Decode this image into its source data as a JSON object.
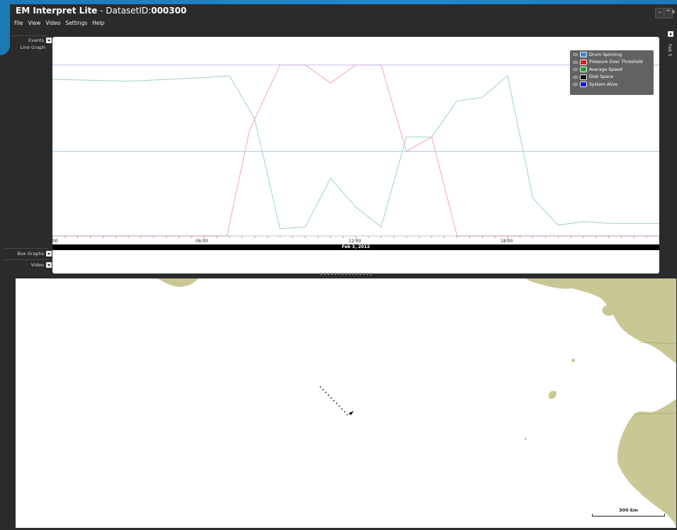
{
  "app": {
    "title_prefix": "EM Interpret Lite",
    "title_sep": " - DatasetID:",
    "dataset_id": "000300",
    "window_controls": {
      "minimize": "–",
      "maximize": "^",
      "close": "x"
    }
  },
  "menu": [
    "File",
    "View",
    "Video",
    "Settings",
    "Help"
  ],
  "rows": {
    "events": "Events",
    "line_graph": "Line Graph",
    "box_graphs": "Box Graphs",
    "video": "Video"
  },
  "timeline": {
    "ticks": [
      "00",
      "06:00",
      "12:00",
      "18:00"
    ],
    "date": "Feb 3, 2012",
    "side_date": "Feb 5"
  },
  "legend": [
    {
      "label": "Drum Spinning",
      "color": "#3a8de0",
      "icon": "eye-icon"
    },
    {
      "label": "Pressure Over Threshold",
      "color": "#e01a1a",
      "icon": "eye-icon"
    },
    {
      "label": "Average Speed",
      "color": "#22a02a",
      "icon": "eye-icon"
    },
    {
      "label": "Disk Space",
      "color": "#111111",
      "icon": "eye-icon"
    },
    {
      "label": "System Alive",
      "color": "#1a1ae0",
      "icon": "eye-icon"
    }
  ],
  "chart_data": {
    "type": "line",
    "xlabel": "",
    "ylabel": "",
    "x_unit": "hours",
    "xlim": [
      0,
      24
    ],
    "ylim": [
      0,
      1
    ],
    "grid": false,
    "legend_position": "top-right",
    "series": [
      {
        "name": "Average Speed",
        "color": "#9bd1c6",
        "x": [
          0,
          3,
          6,
          7,
          8,
          9,
          10,
          11,
          12,
          13,
          14,
          15,
          16,
          17,
          18,
          19,
          20,
          21,
          22,
          24
        ],
        "y": [
          0.87,
          0.86,
          0.88,
          0.89,
          0.65,
          0.04,
          0.05,
          0.32,
          0.16,
          0.05,
          0.55,
          0.55,
          0.75,
          0.77,
          0.89,
          0.21,
          0.06,
          0.08,
          0.07,
          0.07
        ]
      },
      {
        "name": "Pressure Over Threshold",
        "color": "#f0a0c8",
        "x": [
          0,
          6.9,
          7.8,
          9,
          10,
          11,
          12,
          13,
          14,
          15,
          16,
          24
        ],
        "y": [
          0,
          0,
          0.59,
          0.95,
          0.95,
          0.85,
          0.95,
          0.95,
          0.47,
          0.55,
          0,
          0
        ]
      },
      {
        "name": "Drum Spinning",
        "color": "#a8c8e8",
        "x": [
          0,
          24
        ],
        "y": [
          0.47,
          0.47
        ]
      },
      {
        "name": "System Alive",
        "color": "#c8b8f0",
        "x": [
          0,
          24
        ],
        "y": [
          0.95,
          0.95
        ]
      }
    ]
  },
  "map": {
    "scale_label": "300 km",
    "land_color": "#c9c894",
    "track_color": "#000000"
  }
}
